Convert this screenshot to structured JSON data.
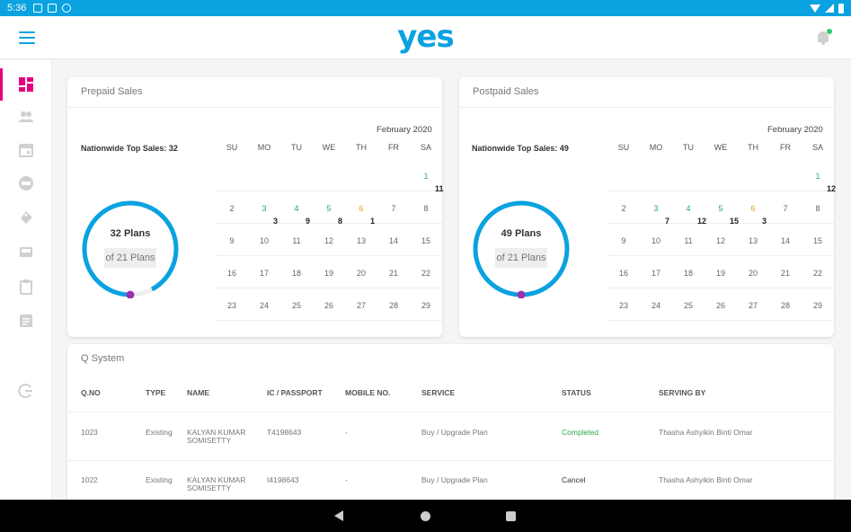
{
  "status_bar": {
    "time": "5:36"
  },
  "app": {
    "logo": "yes"
  },
  "sidebar": {
    "items": [
      {
        "name": "dashboard-icon",
        "active": true
      },
      {
        "name": "users-icon"
      },
      {
        "name": "calendar-icon"
      },
      {
        "name": "yes-badge-icon"
      },
      {
        "name": "tag-icon"
      },
      {
        "name": "inbox-icon"
      },
      {
        "name": "clipboard-icon"
      },
      {
        "name": "document-icon"
      },
      {
        "name": "logout-icon"
      }
    ]
  },
  "prepaid": {
    "title": "Prepaid Sales",
    "month": "February 2020",
    "nationwide": "Nationwide Top Sales: 32",
    "plans_main": "32 Plans",
    "plans_sub": "of 21 Plans",
    "progress": 0.92,
    "weekdays": [
      "SU",
      "MO",
      "TU",
      "WE",
      "TH",
      "FR",
      "SA"
    ],
    "weeks": [
      [
        "",
        "",
        "",
        "",
        "",
        "",
        "1"
      ],
      [
        "2",
        "3",
        "4",
        "5",
        "6",
        "7",
        "8"
      ],
      [
        "9",
        "10",
        "11",
        "12",
        "13",
        "14",
        "15"
      ],
      [
        "16",
        "17",
        "18",
        "19",
        "20",
        "21",
        "22"
      ],
      [
        "23",
        "24",
        "25",
        "26",
        "27",
        "28",
        "29"
      ]
    ],
    "counts": [
      {
        "week": 0,
        "col": 6,
        "value": "11"
      },
      {
        "week": 1,
        "col": 1,
        "value": "3"
      },
      {
        "week": 1,
        "col": 2,
        "value": "9"
      },
      {
        "week": 1,
        "col": 3,
        "value": "8"
      },
      {
        "week": 1,
        "col": 4,
        "value": "1"
      }
    ],
    "highlight": {
      "1": "green",
      "3": "green",
      "4": "green",
      "5": "green",
      "6": "orange"
    }
  },
  "postpaid": {
    "title": "Postpaid Sales",
    "month": "February 2020",
    "nationwide": "Nationwide Top Sales: 49",
    "plans_main": "49 Plans",
    "plans_sub": "of 21 Plans",
    "progress": 1.0,
    "weekdays": [
      "SU",
      "MO",
      "TU",
      "WE",
      "TH",
      "FR",
      "SA"
    ],
    "weeks": [
      [
        "",
        "",
        "",
        "",
        "",
        "",
        "1"
      ],
      [
        "2",
        "3",
        "4",
        "5",
        "6",
        "7",
        "8"
      ],
      [
        "9",
        "10",
        "11",
        "12",
        "13",
        "14",
        "15"
      ],
      [
        "16",
        "17",
        "18",
        "19",
        "20",
        "21",
        "22"
      ],
      [
        "23",
        "24",
        "25",
        "26",
        "27",
        "28",
        "29"
      ]
    ],
    "counts": [
      {
        "week": 0,
        "col": 6,
        "value": "12"
      },
      {
        "week": 1,
        "col": 1,
        "value": "7"
      },
      {
        "week": 1,
        "col": 2,
        "value": "12"
      },
      {
        "week": 1,
        "col": 3,
        "value": "15"
      },
      {
        "week": 1,
        "col": 4,
        "value": "3"
      }
    ],
    "highlight": {
      "1": "green",
      "3": "green",
      "4": "green",
      "5": "green",
      "6": "orange"
    }
  },
  "qsystem": {
    "title": "Q System",
    "headers": [
      "Q.NO",
      "TYPE",
      "NAME",
      "IC / PASSPORT",
      "MOBILE NO.",
      "SERVICE",
      "STATUS",
      "SERVING BY"
    ],
    "rows": [
      {
        "qno": "1023",
        "type": "Existing",
        "name1": "KALYAN KUMAR",
        "name2": "SOMISETTY",
        "ic": "T4198643",
        "mobile": "-",
        "service": "Buy / Upgrade Plan",
        "status": "Completed",
        "serving": "Thasha Ashyikin Binti Omar"
      },
      {
        "qno": "1022",
        "type": "Existing",
        "name1": "KALYAN KUMAR",
        "name2": "SOMISETTY",
        "ic": "I4198643",
        "mobile": "-",
        "service": "Buy / Upgrade Plan",
        "status": "Cancel",
        "serving": "Thasha Ashyikin Binti Omar"
      }
    ]
  },
  "colors": {
    "brand": "#0aa2e0",
    "accent": "#e6007e",
    "marker": "#9b2fae",
    "track": "#eeeeee"
  }
}
